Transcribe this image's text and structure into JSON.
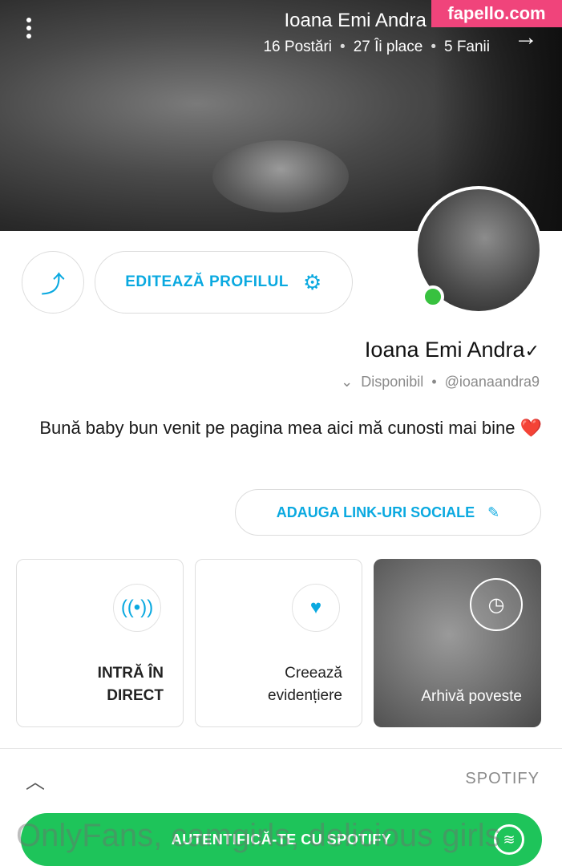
{
  "watermark": "fapello.com",
  "header": {
    "name": "Ioana Emi Andra",
    "stats": [
      "16 Postări",
      "27 Îi place",
      "5 Fanii"
    ],
    "dot": "•",
    "back_icon": "arrow-right-icon"
  },
  "actions": {
    "edit_label": "EDITEAZĂ PROFILUL",
    "social_label": "ADAUGA LINK-URI SOCIALE"
  },
  "profile": {
    "name": "Ioana Emi Andra",
    "handle": "@ioanaandra9",
    "status": "Disponibil",
    "bio": "Bună baby bun venit pe pagina mea aici mă cunosti mai bine",
    "bio_emoji": "❤️"
  },
  "cards": {
    "live_line1": "INTRĂ ÎN",
    "live_line2": "DIRECT",
    "highlight_line1": "Creează",
    "highlight_line2": "evidențiere",
    "archive": "Arhivă poveste"
  },
  "spotify": {
    "section_title": "SPOTIFY",
    "button_label": "AUTENTIFICĂ-TE CU SPOTIFY"
  },
  "bottom_watermark": "OnlyFans, camgirls, delicious girls",
  "colors": {
    "accent": "#0aa9e0",
    "online": "#38c13f",
    "spotify": "#1ec45a",
    "watermark": "#f0447b"
  }
}
